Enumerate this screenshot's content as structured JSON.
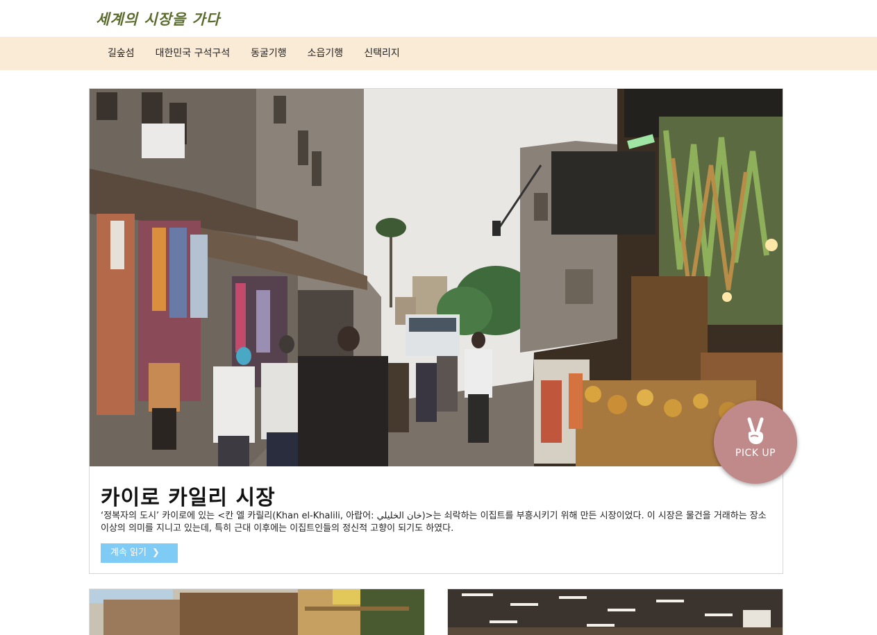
{
  "header": {
    "logo": "세계의 시장을 가다"
  },
  "nav": {
    "items": [
      {
        "label": "길숲섬"
      },
      {
        "label": "대한민국 구석구석"
      },
      {
        "label": "동굴기행"
      },
      {
        "label": "소읍기행"
      },
      {
        "label": "신택리지"
      }
    ]
  },
  "feature": {
    "title": "카이로 카일리 시장",
    "description": "‘정복자의 도시’ 카이로에 있는 <칸 엘 카릴리(Khan el-Khalili, 아랍어: خان الخليلي)>는 쇠락하는 이집트를 부흥시키기 위해 만든 시장이었다. 이 시장은 물건을 거래하는 장소 이상의 의미를 지니고 있는데, 특히 근대 이후에는 이집트인들의 정신적 고향이 되기도 하였다.",
    "read_more_label": "계속 읽기",
    "read_more_icon": "chevron-right-icon",
    "badge_label": "PICK UP",
    "badge_icon": "victory-hand-icon",
    "badge_color": "#c08a8a"
  },
  "colors": {
    "nav_background": "#faebd7",
    "button": "#7ecbf5",
    "logo": "#5a6b2c"
  }
}
